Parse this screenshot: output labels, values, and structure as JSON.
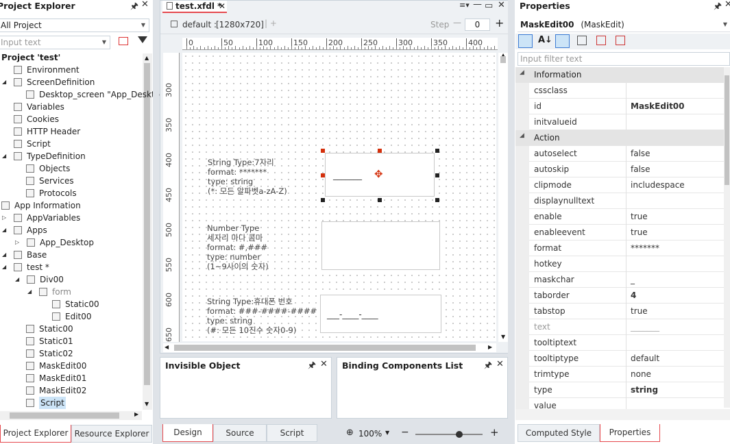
{
  "project_explorer": {
    "title": "Project Explorer",
    "filter_value": "All Project",
    "search_placeholder": "Input text",
    "tree": [
      {
        "label": "Project 'test'",
        "bold": true
      },
      {
        "label": "Environment"
      },
      {
        "label": "ScreenDefinition"
      },
      {
        "label": "Desktop_screen \"App_Deskto"
      },
      {
        "label": "Variables"
      },
      {
        "label": "Cookies"
      },
      {
        "label": "HTTP Header"
      },
      {
        "label": "Script"
      },
      {
        "label": "TypeDefinition"
      },
      {
        "label": "Objects"
      },
      {
        "label": "Services"
      },
      {
        "label": "Protocols"
      },
      {
        "label": "App Information"
      },
      {
        "label": "AppVariables"
      },
      {
        "label": "Apps"
      },
      {
        "label": "App_Desktop"
      },
      {
        "label": "Base"
      },
      {
        "label": "test *"
      },
      {
        "label": "Div00"
      },
      {
        "label": "form"
      },
      {
        "label": "Static00"
      },
      {
        "label": "Edit00"
      },
      {
        "label": "Static00"
      },
      {
        "label": "Static01"
      },
      {
        "label": "Static02"
      },
      {
        "label": "MaskEdit00"
      },
      {
        "label": "MaskEdit01"
      },
      {
        "label": "MaskEdit02"
      },
      {
        "label": "Script"
      }
    ],
    "bottom_tabs": [
      "Project Explorer",
      "Resource Explorer"
    ]
  },
  "editor": {
    "tab_title": "test.xfdl *",
    "screen_label": "default :",
    "screen_size": "[1280x720]",
    "step_label": "Step",
    "step_value": "0",
    "ruler_top": [
      "0",
      "50",
      "100",
      "150",
      "200",
      "250",
      "300",
      "350",
      "400",
      "4"
    ],
    "ruler_left": [
      "300",
      "350",
      "400",
      "450",
      "500",
      "550",
      "600",
      "650"
    ],
    "blocks": [
      {
        "lines": "String Type:7자리\nformat: *******\ntype: string\n(*: 모든 알파벳a-zA-Z)",
        "mask": "_______"
      },
      {
        "lines": "Number Type\n세자리 마다 콤마\nformat: #,###\ntype: number\n(1~9사이의 숫자)",
        "mask": ""
      },
      {
        "lines": "String Type:휴대폰 번호\nformat: ###-####-####\ntype: string\n(#: 모든 10진수 숫자0-9)",
        "mask": "___-____-____"
      }
    ],
    "bottom_tabs": [
      "Design",
      "Source",
      "Script"
    ],
    "zoom": "100%",
    "zoom_fraction": 0.65
  },
  "invisible_panel": {
    "title": "Invisible Object"
  },
  "binding_panel": {
    "title": "Binding Components List"
  },
  "properties": {
    "title": "Properties",
    "object_name": "MaskEdit00",
    "object_type": "(MaskEdit)",
    "filter_placeholder": "Input filter text",
    "rows": [
      {
        "cat": true,
        "name": "Information"
      },
      {
        "name": "cssclass",
        "value": ""
      },
      {
        "name": "id",
        "value": "MaskEdit00",
        "bold": true
      },
      {
        "name": "initvalueid",
        "value": ""
      },
      {
        "cat": true,
        "name": "Action"
      },
      {
        "name": "autoselect",
        "value": "false"
      },
      {
        "name": "autoskip",
        "value": "false"
      },
      {
        "name": "clipmode",
        "value": "includespace"
      },
      {
        "name": "displaynulltext",
        "value": ""
      },
      {
        "name": "enable",
        "value": "true"
      },
      {
        "name": "enableevent",
        "value": "true"
      },
      {
        "name": "format",
        "value": "*******"
      },
      {
        "name": "hotkey",
        "value": ""
      },
      {
        "name": "maskchar",
        "value": "_"
      },
      {
        "name": "taborder",
        "value": "4",
        "bold": true
      },
      {
        "name": "tabstop",
        "value": "true"
      },
      {
        "name": "text",
        "value": "_______",
        "gray": true
      },
      {
        "name": "tooltiptext",
        "value": ""
      },
      {
        "name": "tooltiptype",
        "value": "default"
      },
      {
        "name": "trimtype",
        "value": "none"
      },
      {
        "name": "type",
        "value": "string",
        "bold": true
      },
      {
        "name": "value",
        "value": ""
      }
    ],
    "bottom_tabs": [
      "Computed Style",
      "Properties"
    ]
  },
  "colors": {
    "accent_red": "#e5484d",
    "handle_red": "#d4300c",
    "selection_blue": "#cce4f7"
  }
}
